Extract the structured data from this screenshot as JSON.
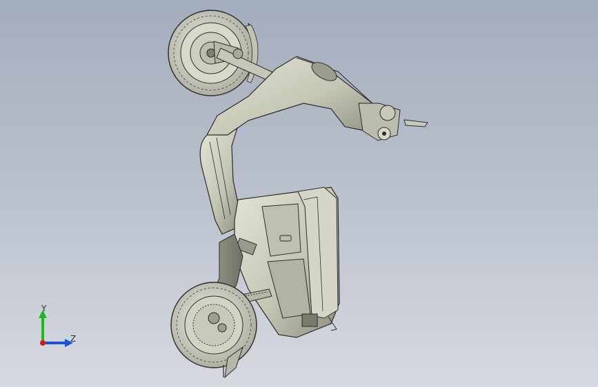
{
  "viewport": {
    "background_top": "#a4adbd",
    "background_bottom": "#d6d9df",
    "model_name": "",
    "model_colors": {
      "body": "#c9c9b8",
      "shadow": "#8e8e80",
      "edge": "#2a2a2a",
      "tire": "#d7d7c9"
    }
  },
  "triad": {
    "y_label": "Y",
    "z_label": "Z",
    "y_color": "#1fb81f",
    "z_color": "#1d4fd8",
    "x_color": "#d01c1c"
  }
}
